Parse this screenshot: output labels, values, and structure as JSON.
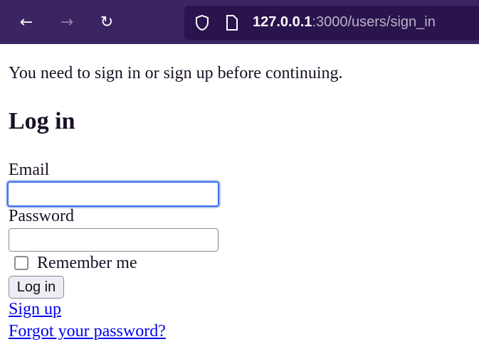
{
  "browser": {
    "url_host": "127.0.0.1",
    "url_rest": ":3000/users/sign_in",
    "icons": [
      "arrow-left-icon",
      "arrow-right-icon",
      "reload-icon",
      "shield-icon",
      "page-icon"
    ]
  },
  "page": {
    "notice": "You need to sign in or sign up before continuing.",
    "title": "Log in",
    "email_label": "Email",
    "email_value": "",
    "password_label": "Password",
    "password_value": "",
    "remember_label": "Remember me",
    "remember_checked": false,
    "submit_label": "Log in",
    "links": {
      "sign_up": "Sign up",
      "forgot": "Forgot your password?"
    }
  }
}
